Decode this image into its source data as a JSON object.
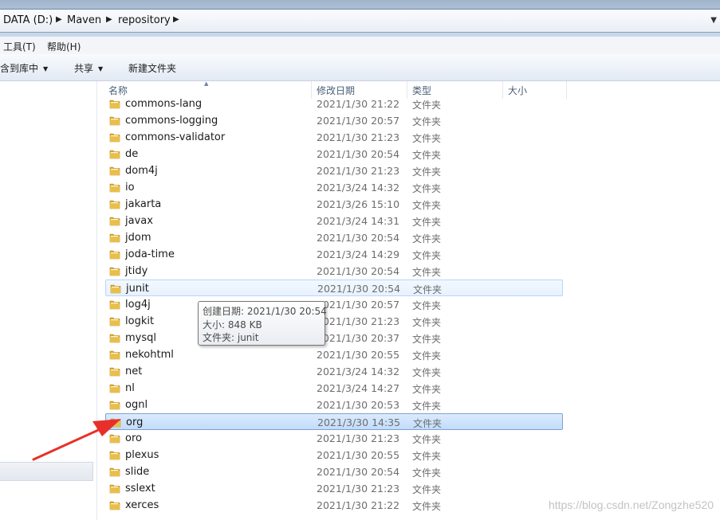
{
  "breadcrumb": {
    "items": [
      "DATA (D:)",
      "Maven",
      "repository"
    ]
  },
  "menu": {
    "tools": "工具(T)",
    "help": "帮助(H)"
  },
  "toolbar": {
    "include_in_library": "含到库中",
    "share": "共享",
    "new_folder": "新建文件夹"
  },
  "columns": {
    "name": "名称",
    "date_modified": "修改日期",
    "type": "类型",
    "size": "大小"
  },
  "files": [
    {
      "name": "commons-lang",
      "date": "2021/1/30 21:22",
      "type": "文件夹"
    },
    {
      "name": "commons-logging",
      "date": "2021/1/30 20:57",
      "type": "文件夹"
    },
    {
      "name": "commons-validator",
      "date": "2021/1/30 21:23",
      "type": "文件夹"
    },
    {
      "name": "de",
      "date": "2021/1/30 20:54",
      "type": "文件夹"
    },
    {
      "name": "dom4j",
      "date": "2021/1/30 21:23",
      "type": "文件夹"
    },
    {
      "name": "io",
      "date": "2021/3/24 14:32",
      "type": "文件夹"
    },
    {
      "name": "jakarta",
      "date": "2021/3/26 15:10",
      "type": "文件夹"
    },
    {
      "name": "javax",
      "date": "2021/3/24 14:31",
      "type": "文件夹"
    },
    {
      "name": "jdom",
      "date": "2021/1/30 20:54",
      "type": "文件夹"
    },
    {
      "name": "joda-time",
      "date": "2021/3/24 14:29",
      "type": "文件夹"
    },
    {
      "name": "jtidy",
      "date": "2021/1/30 20:54",
      "type": "文件夹"
    },
    {
      "name": "junit",
      "date": "2021/1/30 20:54",
      "type": "文件夹"
    },
    {
      "name": "log4j",
      "date": "2021/1/30 20:57",
      "type": "文件夹"
    },
    {
      "name": "logkit",
      "date": "2021/1/30 21:23",
      "type": "文件夹"
    },
    {
      "name": "mysql",
      "date": "2021/1/30 20:37",
      "type": "文件夹"
    },
    {
      "name": "nekohtml",
      "date": "2021/1/30 20:55",
      "type": "文件夹"
    },
    {
      "name": "net",
      "date": "2021/3/24 14:32",
      "type": "文件夹"
    },
    {
      "name": "nl",
      "date": "2021/3/24 14:27",
      "type": "文件夹"
    },
    {
      "name": "ognl",
      "date": "2021/1/30 20:53",
      "type": "文件夹"
    },
    {
      "name": "org",
      "date": "2021/3/30 14:35",
      "type": "文件夹"
    },
    {
      "name": "oro",
      "date": "2021/1/30 21:23",
      "type": "文件夹"
    },
    {
      "name": "plexus",
      "date": "2021/1/30 20:55",
      "type": "文件夹"
    },
    {
      "name": "slide",
      "date": "2021/1/30 20:54",
      "type": "文件夹"
    },
    {
      "name": "sslext",
      "date": "2021/1/30 21:23",
      "type": "文件夹"
    },
    {
      "name": "xerces",
      "date": "2021/1/30 21:22",
      "type": "文件夹"
    }
  ],
  "hovered_file": "junit",
  "selected_file": "org",
  "tooltip": {
    "created": "创建日期: 2021/1/30 20:54",
    "size": "大小: 848 KB",
    "folder": "文件夹: junit"
  },
  "watermark": "https://blog.csdn.net/Zongzhe520",
  "colors": {
    "selection": "#c1dcfc",
    "selection_border": "#7da2ce",
    "hover_border": "#b8d6fb",
    "folder": "#e8bf4a",
    "annotation_arrow": "#e8302a"
  },
  "icons": {
    "folder": "folder-icon",
    "breadcrumb_separator": "chevron-right-icon",
    "dropdown": "caret-down-icon"
  }
}
